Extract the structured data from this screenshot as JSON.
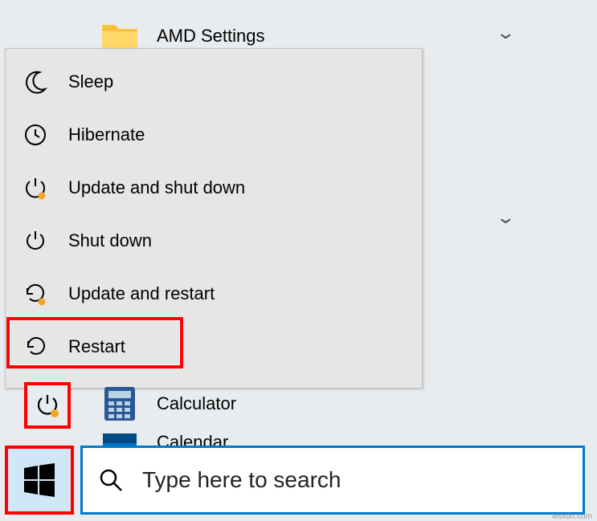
{
  "bg_apps": {
    "item0": "AMD Settings",
    "calculator": "Calculator",
    "calendar": "Calendar"
  },
  "power_menu": {
    "sleep": "Sleep",
    "hibernate": "Hibernate",
    "update_shutdown": "Update and shut down",
    "shutdown": "Shut down",
    "update_restart": "Update and restart",
    "restart": "Restart"
  },
  "search": {
    "placeholder": "Type here to search"
  },
  "attribution": "wsxdn.com"
}
